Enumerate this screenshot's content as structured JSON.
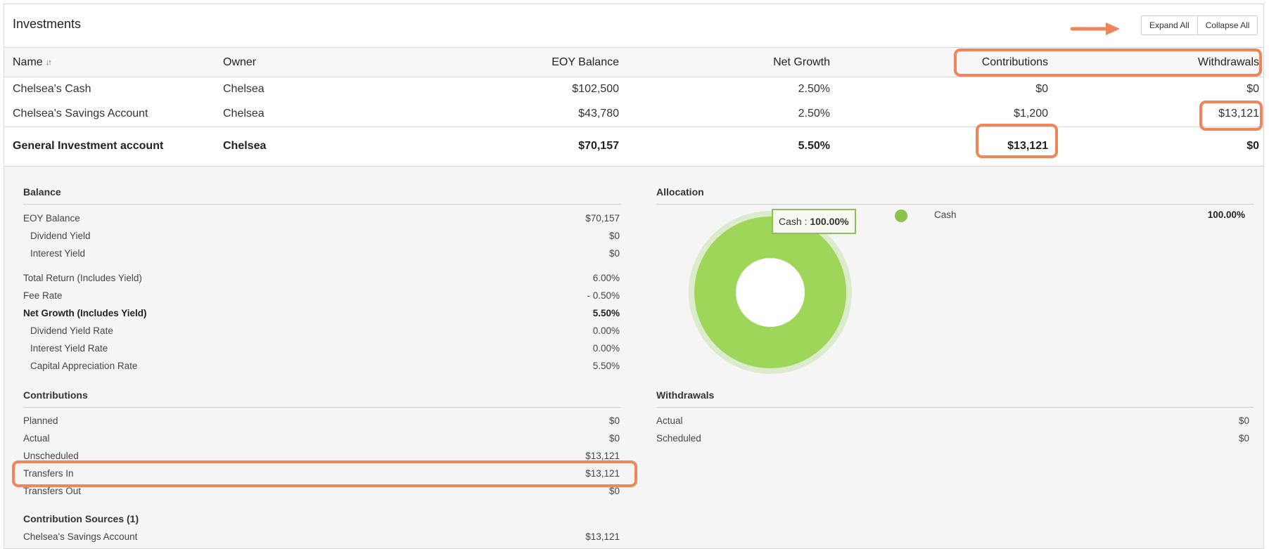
{
  "header": {
    "title": "Investments",
    "expand_all": "Expand All",
    "collapse_all": "Collapse All"
  },
  "columns": {
    "name": "Name",
    "sort_icon": "↓↑",
    "owner": "Owner",
    "eoy_balance": "EOY Balance",
    "net_growth": "Net Growth",
    "contributions": "Contributions",
    "withdrawals": "Withdrawals"
  },
  "rows": [
    {
      "name": "Chelsea's Cash",
      "owner": "Chelsea",
      "eoy_balance": "$102,500",
      "net_growth": "2.50%",
      "contributions": "$0",
      "withdrawals": "$0"
    },
    {
      "name": "Chelsea's Savings Account",
      "owner": "Chelsea",
      "eoy_balance": "$43,780",
      "net_growth": "2.50%",
      "contributions": "$1,200",
      "withdrawals": "$13,121"
    },
    {
      "name": "General Investment account",
      "owner": "Chelsea",
      "eoy_balance": "$70,157",
      "net_growth": "5.50%",
      "contributions": "$13,121",
      "withdrawals": "$0"
    }
  ],
  "balance": {
    "title": "Balance",
    "items": [
      {
        "label": "EOY Balance",
        "value": "$70,157"
      },
      {
        "label": "Dividend Yield",
        "value": "$0"
      },
      {
        "label": "Interest Yield",
        "value": "$0"
      },
      {
        "label": "Total Return (Includes Yield)",
        "value": "6.00%"
      },
      {
        "label": "Fee Rate",
        "value": "- 0.50%"
      },
      {
        "label": "Net Growth (Includes Yield)",
        "value": "5.50%"
      },
      {
        "label": "Dividend Yield Rate",
        "value": "0.00%"
      },
      {
        "label": "Interest Yield Rate",
        "value": "0.00%"
      },
      {
        "label": "Capital Appreciation Rate",
        "value": "5.50%"
      }
    ]
  },
  "contributions": {
    "title": "Contributions",
    "items": [
      {
        "label": "Planned",
        "value": "$0"
      },
      {
        "label": "Actual",
        "value": "$0"
      },
      {
        "label": "Unscheduled",
        "value": "$13,121"
      },
      {
        "label": "Transfers In",
        "value": "$13,121"
      },
      {
        "label": "Transfers Out",
        "value": "$0"
      }
    ],
    "sources_title": "Contribution Sources (1)",
    "sources": [
      {
        "label": "Chelsea's Savings Account",
        "value": "$13,121"
      }
    ]
  },
  "allocation": {
    "title": "Allocation",
    "tooltip_label": "Cash : ",
    "tooltip_value": "100.00%",
    "legend": [
      {
        "label": "Cash",
        "value": "100.00%",
        "color": "#8bc34a"
      }
    ]
  },
  "withdrawals": {
    "title": "Withdrawals",
    "items": [
      {
        "label": "Actual",
        "value": "$0"
      },
      {
        "label": "Scheduled",
        "value": "$0"
      }
    ]
  },
  "colors": {
    "highlight": "#ef8558",
    "donut": "#9ed65a",
    "donut_halo": "#dcebcb"
  }
}
